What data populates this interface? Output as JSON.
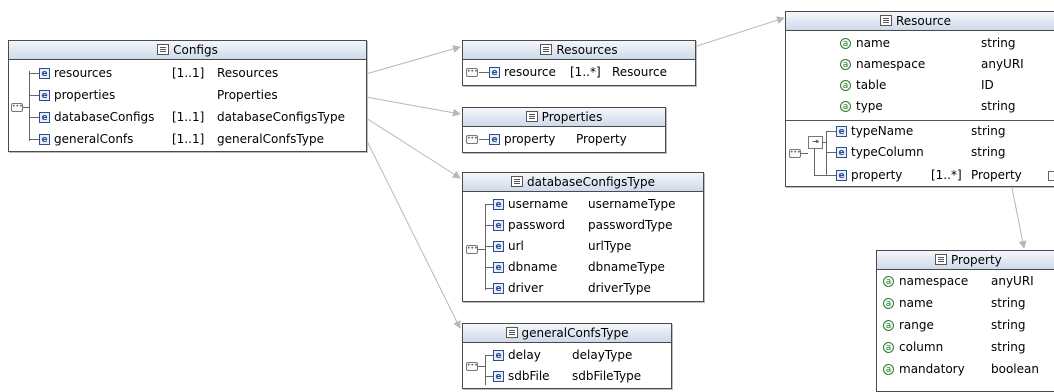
{
  "configs": {
    "title": "Configs",
    "rows": [
      {
        "name": "resources",
        "card": "[1..1]",
        "type": "Resources"
      },
      {
        "name": "properties",
        "card": "",
        "type": "Properties"
      },
      {
        "name": "databaseConfigs",
        "card": "[1..1]",
        "type": "databaseConfigsType"
      },
      {
        "name": "generalConfs",
        "card": "[1..1]",
        "type": "generalConfsType"
      }
    ]
  },
  "resources": {
    "title": "Resources",
    "rows": [
      {
        "name": "resource",
        "card": "[1..*]",
        "type": "Resource"
      }
    ]
  },
  "properties": {
    "title": "Properties",
    "rows": [
      {
        "name": "property",
        "type": "Property"
      }
    ]
  },
  "databaseConfigsType": {
    "title": "databaseConfigsType",
    "rows": [
      {
        "name": "username",
        "type": "usernameType"
      },
      {
        "name": "password",
        "type": "passwordType"
      },
      {
        "name": "url",
        "type": "urlType"
      },
      {
        "name": "dbname",
        "type": "dbnameType"
      },
      {
        "name": "driver",
        "type": "driverType"
      }
    ]
  },
  "generalConfsType": {
    "title": "generalConfsType",
    "rows": [
      {
        "name": "delay",
        "type": "delayType"
      },
      {
        "name": "sdbFile",
        "type": "sdbFileType"
      }
    ]
  },
  "resource": {
    "title": "Resource",
    "attributes": [
      {
        "name": "name",
        "type": "string"
      },
      {
        "name": "namespace",
        "type": "anyURI"
      },
      {
        "name": "table",
        "type": "ID"
      },
      {
        "name": "type",
        "type": "string"
      }
    ],
    "elements": [
      {
        "name": "typeName",
        "card": "",
        "type": "string"
      },
      {
        "name": "typeColumn",
        "card": "",
        "type": "string"
      },
      {
        "name": "property",
        "card": "[1..*]",
        "type": "Property"
      }
    ]
  },
  "property": {
    "title": "Property",
    "attributes": [
      {
        "name": "namespace",
        "type": "anyURI"
      },
      {
        "name": "name",
        "type": "string"
      },
      {
        "name": "range",
        "type": "string"
      },
      {
        "name": "column",
        "type": "string"
      },
      {
        "name": "mandatory",
        "type": "boolean"
      }
    ]
  },
  "icons": {
    "element": "e",
    "attribute": "a",
    "sequence": "sequence-icon",
    "choice": "choice-icon",
    "complex_type": "complex-type-icon"
  },
  "colors": {
    "header_gradient_top": "#f4f7fb",
    "header_gradient_bottom": "#cfdaea",
    "element_icon": "#2d4f8e",
    "attribute_icon": "#2f7a2f",
    "connector": "#b8b8b8"
  }
}
